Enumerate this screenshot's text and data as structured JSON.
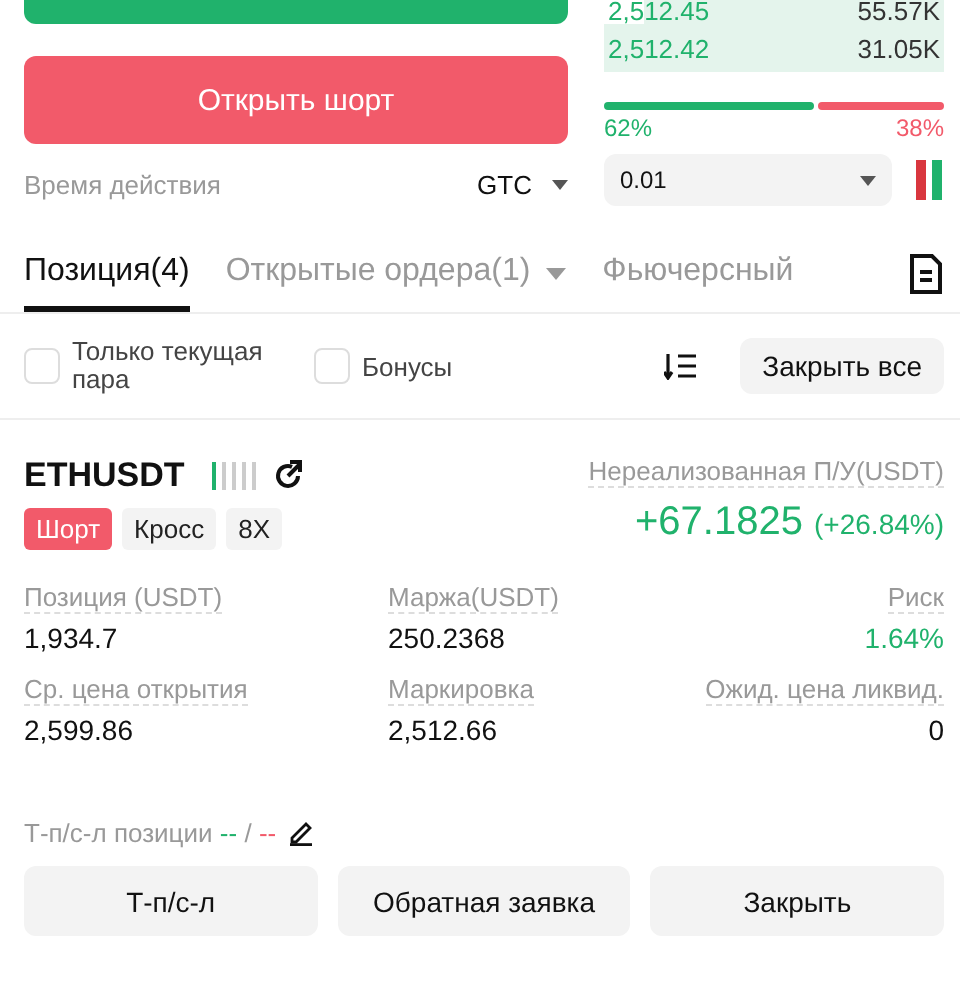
{
  "order_book": [
    {
      "price": "2,512.45",
      "amount": "55.57K",
      "level": 0.88
    },
    {
      "price": "2,512.42",
      "amount": "31.05K",
      "level": 1
    }
  ],
  "short_button": "Открыть шорт",
  "ratio": {
    "level": 0.62,
    "buy": "62%",
    "sell": "38%"
  },
  "validity": {
    "label": "Время действия",
    "value": "GTC"
  },
  "step": {
    "value": "0.01"
  },
  "tabs": [
    {
      "label": "Позиция(4)",
      "selected": true,
      "dropdown": false
    },
    {
      "label": "Открытые ордера(1)",
      "selected": false,
      "dropdown": true
    },
    {
      "label": "Фьючерсный ",
      "selected": false,
      "dropdown": false
    }
  ],
  "filters": [
    {
      "label": "Только текущая пара",
      "checked": false
    },
    {
      "label": "Бонусы",
      "checked": false
    }
  ],
  "close_all": "Закрыть все",
  "position": {
    "symbol": "ETHUSDT",
    "tags": [
      {
        "label": "Шорт",
        "kind": "side"
      },
      {
        "label": "Кросс",
        "kind": "plain"
      },
      {
        "label": "8X",
        "kind": "plain"
      }
    ],
    "pnl_label": "Нереализованная П/У(USDT)",
    "pnl": "+67.1825",
    "pnl_pct": "(+26.84%)",
    "stats": [
      {
        "label": "Позиция (USDT)",
        "value": "1,934.7",
        "kind": "plain"
      },
      {
        "label": "Маржа(USDT)",
        "value": "250.2368",
        "kind": "plain"
      },
      {
        "label": "Риск",
        "value": "1.64%",
        "kind": "good"
      },
      {
        "label": "Ср. цена открытия",
        "value": "2,599.86",
        "kind": "plain"
      },
      {
        "label": "Маркировка",
        "value": "2,512.66",
        "kind": "plain"
      },
      {
        "label": "Ожид. цена ликвид.",
        "value": "0",
        "kind": "plain"
      }
    ],
    "tpsl": {
      "label": "Т-п/с-л позиции",
      "tp": "--",
      "sep": "/",
      "sl": "--"
    },
    "actions": [
      "Т-п/с-л",
      "Обратная заявка",
      "Закрыть"
    ]
  }
}
